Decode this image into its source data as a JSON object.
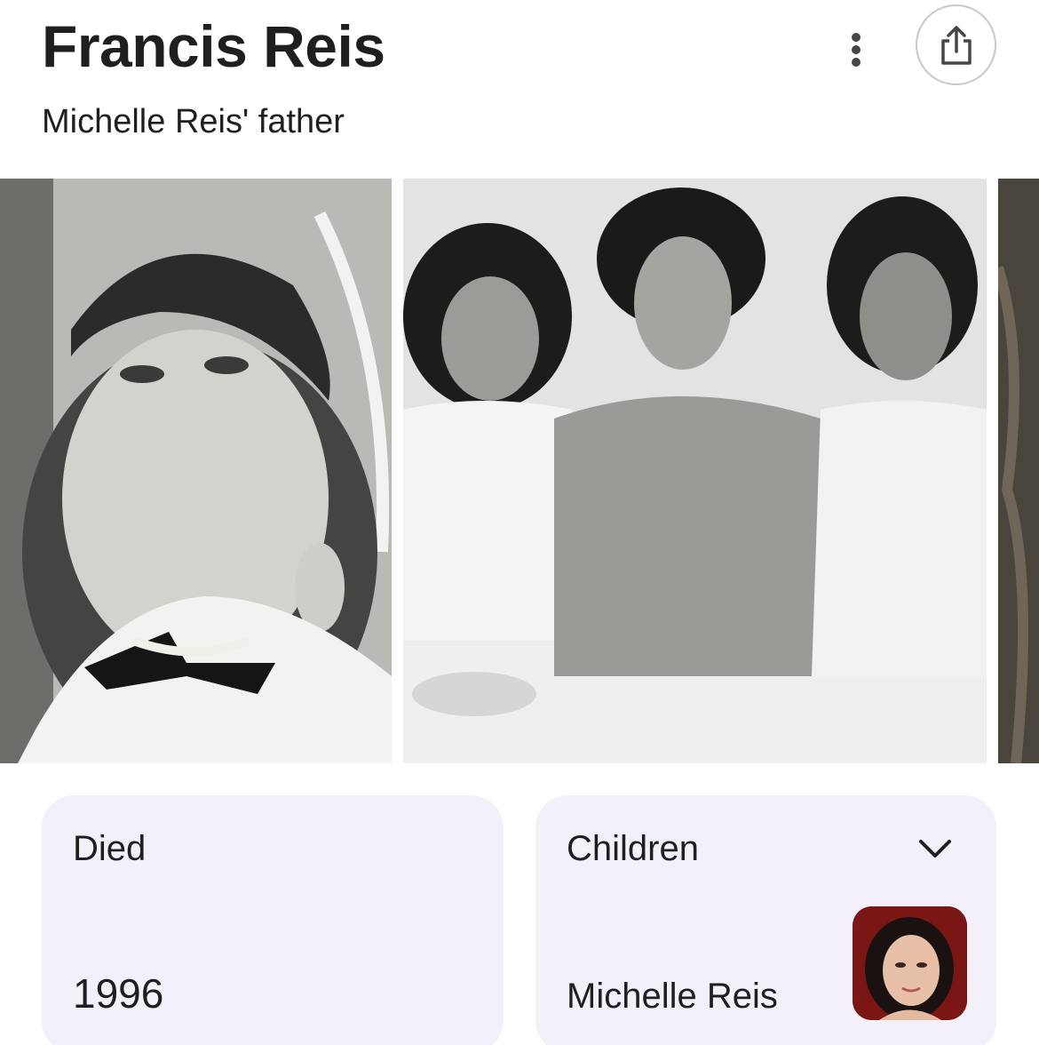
{
  "header": {
    "title": "Francis Reis",
    "subtitle": "Michelle Reis' father"
  },
  "actions": {
    "more_icon": "more-vert-icon",
    "share_icon": "share-icon"
  },
  "images": [
    {
      "name": "photo-francis-reis"
    },
    {
      "name": "photo-family-group"
    },
    {
      "name": "photo-partial"
    }
  ],
  "facts": {
    "died": {
      "label": "Died",
      "value": "1996"
    },
    "children": {
      "label": "Children",
      "value": "Michelle Reis",
      "expand_icon": "chevron-down-icon"
    }
  },
  "colors": {
    "card_background": "#f3f0f9",
    "text": "#1f1f1f",
    "icon": "#444746"
  }
}
